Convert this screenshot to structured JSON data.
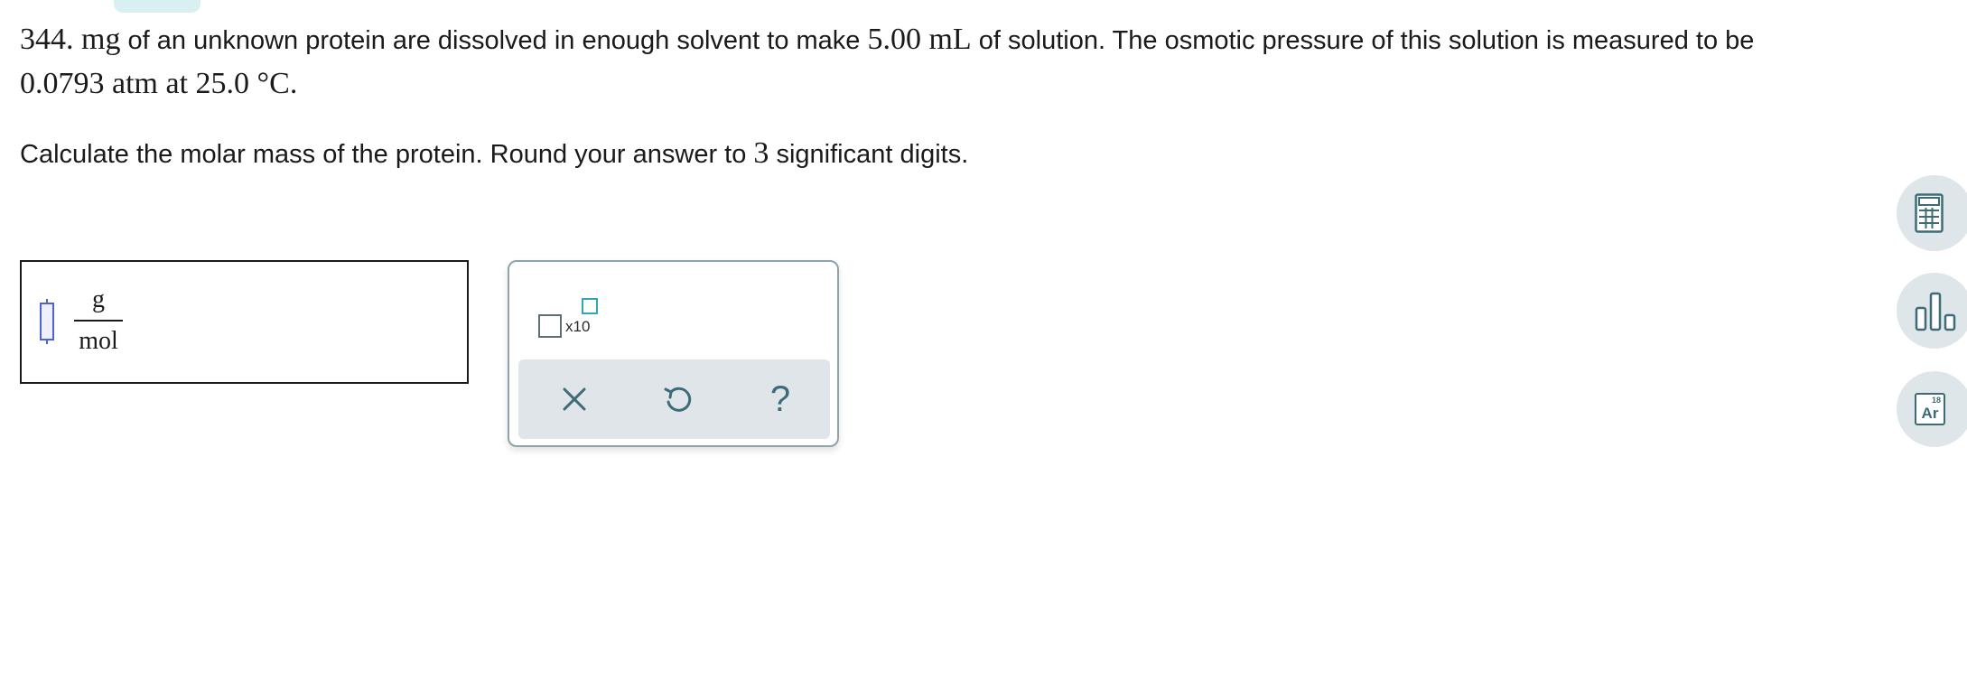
{
  "problem": {
    "mass_value": "344. mg",
    "text1": " of an unknown protein are dissolved in enough solvent to make ",
    "volume_value": "5.00 mL",
    "text2": " of solution. The osmotic pressure of this solution is measured to be",
    "pressure_value": "0.0793 atm",
    "text3": " at ",
    "temperature_value": "25.0 °C",
    "text4": "."
  },
  "question": {
    "text1": "Calculate the molar mass of the protein. Round your answer to ",
    "sig_figs": "3",
    "text2": " significant digits."
  },
  "answer": {
    "value": "",
    "unit_numerator": "g",
    "unit_denominator": "mol"
  },
  "toolbox": {
    "sci_notation_label": "x10"
  },
  "side_tools": {
    "periodic_number": "18",
    "periodic_symbol": "Ar"
  },
  "colors": {
    "accent_teal": "#2fa7b8",
    "icon_slate": "#3d6b78",
    "cursor_blue": "#4f63d8"
  }
}
